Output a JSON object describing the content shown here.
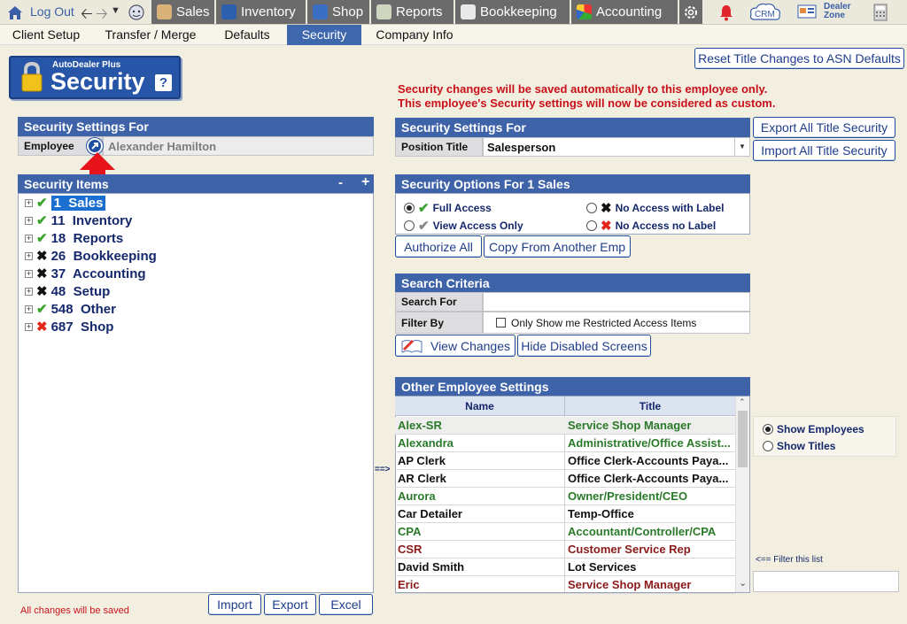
{
  "topnav": {
    "logout": "Log Out",
    "tabs": [
      {
        "label": "Sales",
        "icon": "salesperson-icon"
      },
      {
        "label": "Inventory",
        "icon": "car-icon"
      },
      {
        "label": "Shop",
        "icon": "wrench-icon"
      },
      {
        "label": "Reports",
        "icon": "report-icon"
      },
      {
        "label": "Bookkeeping",
        "icon": "book-icon"
      },
      {
        "label": "Accounting",
        "icon": "pie-chart-icon"
      }
    ],
    "crm": "CRM",
    "dealer_zone": "Dealer Zone"
  },
  "subnav": [
    "Client Setup",
    "Transfer / Merge",
    "Defaults",
    "Security",
    "Company Info"
  ],
  "logo": {
    "small": "AutoDealer Plus",
    "big": "Security",
    "help": "?"
  },
  "reset_button": "Reset Title Changes to ASN Defaults",
  "notice": {
    "line1": "Security changes will be saved automatically to this employee only.",
    "line2": "This employee's Security settings will now be considered as custom."
  },
  "left_panel": {
    "title": "Security Settings For",
    "employee_label": "Employee",
    "employee_value": "Alexander Hamilton"
  },
  "tree": {
    "title": "Security Items",
    "collapse": "-",
    "expand": "+",
    "items": [
      {
        "label": "1  Sales",
        "status": "check"
      },
      {
        "label": "11  Inventory",
        "status": "check"
      },
      {
        "label": "18  Reports",
        "status": "check"
      },
      {
        "label": "26  Bookkeeping",
        "status": "x"
      },
      {
        "label": "37  Accounting",
        "status": "x"
      },
      {
        "label": "48  Setup",
        "status": "x"
      },
      {
        "label": "548  Other",
        "status": "check"
      },
      {
        "label": "687  Shop",
        "status": "xred"
      }
    ]
  },
  "bottom": {
    "import": "Import",
    "export": "Export",
    "excel": "Excel",
    "saved_note": "All changes will be saved"
  },
  "right_panel": {
    "title": "Security Settings For",
    "position_label": "Position Title",
    "position_value": "Salesperson",
    "export_all": "Export All Title Security",
    "import_all": "Import All Title Security"
  },
  "options": {
    "title": "Security Options For 1  Sales",
    "full": "Full Access",
    "view": "View Access Only",
    "no_label": "No Access with Label",
    "no_nolabel": "No Access no Label",
    "authorize": "Authorize All",
    "copy": "Copy From Another Emp"
  },
  "search": {
    "title": "Search Criteria",
    "search_for": "Search For",
    "search_value": "",
    "filter_by": "Filter By",
    "restricted": "Only Show me Restricted Access Items",
    "view_changes": "View Changes",
    "hide_disabled": "Hide Disabled Screens"
  },
  "other": {
    "title": "Other Employee Settings",
    "col_name": "Name",
    "col_title": "Title",
    "arrow": "==>",
    "rows": [
      {
        "name": "Alex-SR",
        "title": "Service Shop Manager",
        "color": "g"
      },
      {
        "name": "Alexandra",
        "title": "Administrative/Office Assist...",
        "color": "g"
      },
      {
        "name": "AP Clerk",
        "title": "Office Clerk-Accounts Paya...",
        "color": "b"
      },
      {
        "name": "AR Clerk",
        "title": "Office Clerk-Accounts Paya...",
        "color": "b"
      },
      {
        "name": "Aurora",
        "title": "Owner/President/CEO",
        "color": "g"
      },
      {
        "name": "Car Detailer",
        "title": "Temp-Office",
        "color": "b"
      },
      {
        "name": "CPA",
        "title": "Accountant/Controller/CPA",
        "color": "g"
      },
      {
        "name": "CSR",
        "title": "Customer Service Rep",
        "color": "r"
      },
      {
        "name": "David Smith",
        "title": "Lot Services",
        "color": "b"
      },
      {
        "name": "Eric",
        "title": "Service Shop Manager",
        "color": "r"
      }
    ],
    "show_employees": "Show Employees",
    "show_titles": "Show Titles",
    "filter_label": "<== Filter this list",
    "filter_value": ""
  }
}
